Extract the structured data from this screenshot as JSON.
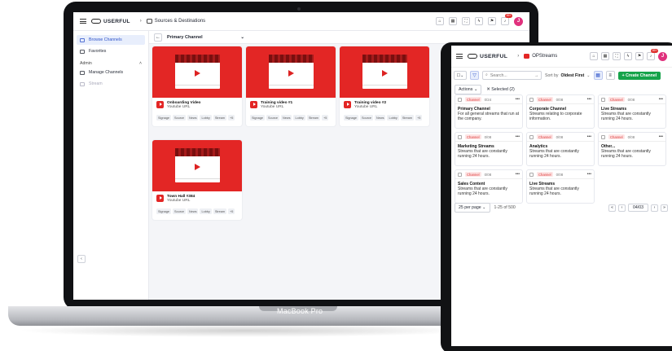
{
  "laptop": {
    "brand": "USERFUL",
    "breadcrumb": "Sources & Destinations",
    "notif_badge": "99+",
    "avatar": "J",
    "sidebar": {
      "items": [
        {
          "label": "Browse Channels",
          "active": true
        },
        {
          "label": "Favorites",
          "active": false
        }
      ],
      "section": "Admin",
      "admin_items": [
        {
          "label": "Manage Channels"
        },
        {
          "label": "Stream"
        }
      ]
    },
    "channel_select": "Primary Channel",
    "cards": [
      {
        "title": "Onboarding Video",
        "subtitle": "Youtube URL",
        "tags": [
          "Signage",
          "Source",
          "News",
          "Lobby",
          "Stream",
          "+5"
        ]
      },
      {
        "title": "Training video #1",
        "subtitle": "Youtube URL",
        "tags": [
          "Signage",
          "Source",
          "News",
          "Lobby",
          "Stream",
          "+5"
        ]
      },
      {
        "title": "Training video #2",
        "subtitle": "Youtube URL",
        "tags": [
          "Signage",
          "Source",
          "News",
          "Lobby",
          "Stream",
          "+5"
        ]
      },
      {
        "title": "Town Hall #384",
        "subtitle": "Youtube URL",
        "tags": [
          "Signage",
          "Source",
          "News",
          "Lobby",
          "Stream",
          "+5"
        ]
      }
    ],
    "device_label": "MacBook Pro"
  },
  "tablet": {
    "brand": "USERFUL",
    "breadcrumb": "OPStreams",
    "notif_badge": "99+",
    "avatar": "J",
    "search_placeholder": "Search...",
    "sort_label": "Sort by",
    "sort_value": "Oldest First",
    "create_label": "+ Create Channel",
    "actions_label": "Actions",
    "selected_label": "Selected (2)",
    "channels": [
      {
        "tag": "Channel",
        "count": "0/24",
        "title": "Primary Channel",
        "desc": "For all general streams that run at the company."
      },
      {
        "tag": "Channel",
        "count": "0/08",
        "title": "Corporate Channel",
        "desc": "Streams relating to corporate information."
      },
      {
        "tag": "Channel",
        "count": "0/08",
        "title": "Live Streams",
        "desc": "Streams that are constantly running 24 hours."
      },
      {
        "tag": "Channel",
        "count": "0/08",
        "title": "Marketing Streams",
        "desc": "Streams that are constantly running 24 hours."
      },
      {
        "tag": "Channel",
        "count": "0/08",
        "title": "Analytics",
        "desc": "Streams that are constantly running 24 hours."
      },
      {
        "tag": "Channel",
        "count": "0/08",
        "title": "Other...",
        "desc": "Streams that are constantly running 24 hours."
      },
      {
        "tag": "Channel",
        "count": "0/08",
        "title": "Sales Content",
        "desc": "Streams that are constantly running 24 hours."
      },
      {
        "tag": "Channel",
        "count": "0/08",
        "title": "Live Streams",
        "desc": "Streams that are constantly running 24 hours."
      }
    ],
    "per_page": "25 per page",
    "range": "1-25 of 500",
    "page": "04/03"
  }
}
